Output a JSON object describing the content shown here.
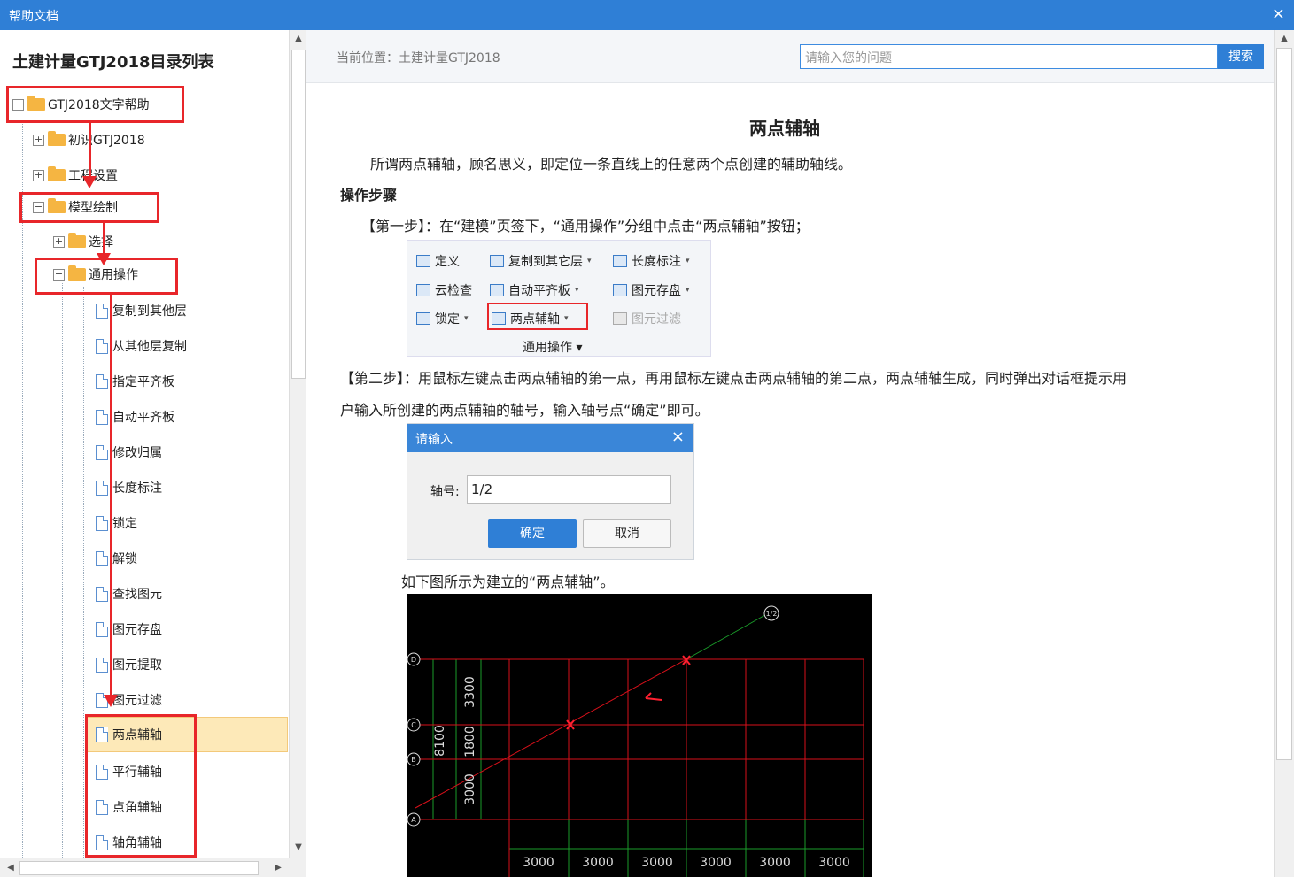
{
  "window": {
    "title": "帮助文档",
    "close_glyph": "×"
  },
  "left": {
    "title": "土建计量GTJ2018目录列表",
    "tree": [
      {
        "label": "GTJ2018文字帮助",
        "toggle": "−"
      },
      {
        "label": "初识GTJ2018",
        "toggle": "+"
      },
      {
        "label": "工程设置",
        "toggle": "+"
      },
      {
        "label": "模型绘制",
        "toggle": "−"
      },
      {
        "label": "选择",
        "toggle": "+"
      },
      {
        "label": "通用操作",
        "toggle": "−"
      },
      {
        "label": "复制到其他层"
      },
      {
        "label": "从其他层复制"
      },
      {
        "label": "指定平齐板"
      },
      {
        "label": "自动平齐板"
      },
      {
        "label": "修改归属"
      },
      {
        "label": "长度标注"
      },
      {
        "label": "锁定"
      },
      {
        "label": "解锁"
      },
      {
        "label": "查找图元"
      },
      {
        "label": "图元存盘"
      },
      {
        "label": "图元提取"
      },
      {
        "label": "图元过滤"
      },
      {
        "label": "两点辅轴",
        "selected": true
      },
      {
        "label": "平行辅轴"
      },
      {
        "label": "点角辅轴"
      },
      {
        "label": "轴角辅轴"
      }
    ]
  },
  "right": {
    "breadcrumb": "当前位置：土建计量GTJ2018",
    "search_placeholder": "请输入您的问题",
    "search_button": "搜索",
    "heading": "两点辅轴",
    "intro": "所谓两点辅轴，顾名思义，即定位一条直线上的任意两个点创建的辅助轴线。",
    "steps_title": "操作步骤",
    "step1": "【第一步】：在“建模”页签下，“通用操作”分组中点击“两点辅轴”按钮；",
    "step2_line1": "【第二步】：用鼠标左键点击两点辅轴的第一点，再用鼠标左键点击两点辅轴的第二点，两点辅轴生成，同时弹出对话框提示用",
    "step2_line2": "户输入所创建的两点辅轴的轴号，输入轴号点“确定”即可。",
    "figure_caption": "如下图所示为建立的“两点辅轴”。"
  },
  "ribbon": {
    "row1": [
      "定义",
      "复制到其它层",
      "长度标注"
    ],
    "row2": [
      "云检查",
      "自动平齐板",
      "图元存盘"
    ],
    "row3": [
      "锁定",
      "两点辅轴",
      "图元过滤"
    ],
    "group": "通用操作",
    "dropdown_glyph": "▾"
  },
  "dialog": {
    "title": "请输入",
    "close_glyph": "×",
    "field_label": "轴号:",
    "field_value": "1/2",
    "ok": "确定",
    "cancel": "取消"
  },
  "cad": {
    "axis_labels_left": [
      "D",
      "C",
      "B",
      "A"
    ],
    "axis_label_top": "1/2",
    "dims_vertical": [
      "3300",
      "1800",
      "3000"
    ],
    "dim_total": "8100",
    "dims_bottom": [
      "3000",
      "3000",
      "3000",
      "3000",
      "3000",
      "3000"
    ]
  }
}
